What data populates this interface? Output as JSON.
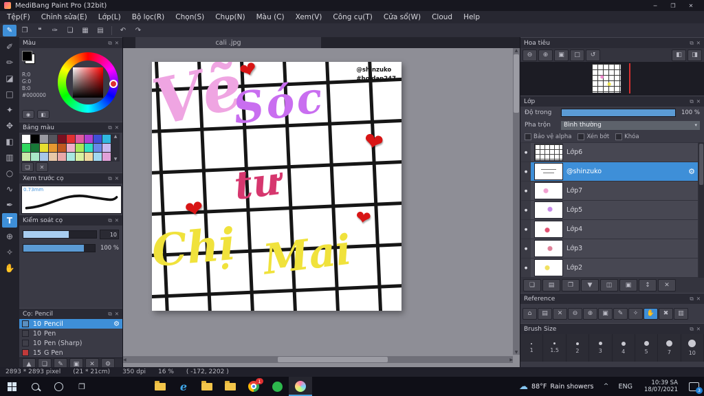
{
  "icons": {
    "minimize": "─",
    "restore": "❐",
    "close": "✕",
    "popout": "⧉",
    "panel_close": "✕",
    "undo": "↶",
    "redo": "↷",
    "gear": "⚙",
    "eye": "●",
    "scroll_up": "▲",
    "scroll_down": "▼",
    "scroll_left": "◀",
    "scroll_right": "▶",
    "dropdown": "▾",
    "chevron_up": "^",
    "taskview": "❐",
    "edge": "e"
  },
  "window": {
    "title": "MediBang Paint Pro (32bit)"
  },
  "menu": {
    "items": [
      "Tệp(F)",
      "Chỉnh sửa(E)",
      "Lớp(L)",
      "Bộ lọc(R)",
      "Chọn(S)",
      "Chụp(N)",
      "Màu (C)",
      "Xem(V)",
      "Công cụ(T)",
      "Cửa sổ(W)",
      "Cloud",
      "Help"
    ]
  },
  "toolbar": {
    "buttons": [
      {
        "name": "paint-mode",
        "glyph": "✎"
      },
      {
        "name": "copy",
        "glyph": "❐"
      },
      {
        "name": "comment",
        "glyph": "❝"
      },
      {
        "name": "brush-edit",
        "glyph": "✑"
      },
      {
        "name": "pages",
        "glyph": "❏"
      },
      {
        "name": "grid-view",
        "glyph": "▦"
      },
      {
        "name": "material-view",
        "glyph": "▤"
      }
    ]
  },
  "tools": [
    {
      "name": "brush-tool",
      "glyph": "✐"
    },
    {
      "name": "pencil-tool",
      "glyph": "✏"
    },
    {
      "name": "eraser-tool",
      "glyph": "◪"
    },
    {
      "name": "select-rect-tool",
      "glyph": "□"
    },
    {
      "name": "magic-wand-tool",
      "glyph": "✦"
    },
    {
      "name": "move-tool",
      "glyph": "✥"
    },
    {
      "name": "fill-tool",
      "glyph": "◧"
    },
    {
      "name": "gradient-tool",
      "glyph": "▥"
    },
    {
      "name": "shape-tool",
      "glyph": "○"
    },
    {
      "name": "lasso-tool",
      "glyph": "∿"
    },
    {
      "name": "pen-tool",
      "glyph": "✒"
    },
    {
      "name": "text-tool",
      "glyph": "T"
    },
    {
      "name": "zoom-tool",
      "glyph": "⊕"
    },
    {
      "name": "eyedropper-tool",
      "glyph": "✧"
    },
    {
      "name": "hand-tool",
      "glyph": "✋"
    }
  ],
  "color_panel": {
    "title": "Màu",
    "r": "R:0",
    "g": "G:0",
    "b": "B:0",
    "hex": "#000000",
    "buttons": [
      {
        "glyph": "◉"
      },
      {
        "glyph": "◧"
      }
    ]
  },
  "palette_panel": {
    "title": "Bảng màu",
    "colors": [
      "#ffffff",
      "#000000",
      "#9a9aa2",
      "#55555d",
      "#7a1020",
      "#e03030",
      "#e05aa0",
      "#b040d0",
      "#4050d8",
      "#30b8e0",
      "#30d860",
      "#187838",
      "#e8e030",
      "#e89830",
      "#c05820",
      "#f0b0c8",
      "#a8e858",
      "#30e0c0",
      "#6888e8",
      "#c8b8f0",
      "#c8e8a8",
      "#a8e8c8",
      "#a8c8e8",
      "#e8c8a8",
      "#e8a8a8",
      "#a8e8e0",
      "#d8f0a0",
      "#f0d8a0",
      "#a0d8f0",
      "#e0a0d8"
    ],
    "actions": [
      {
        "glyph": "❏"
      },
      {
        "glyph": "✕"
      }
    ]
  },
  "preview_panel": {
    "title": "Xem trước cọ",
    "size_label": "0.73mm"
  },
  "control_panel": {
    "title": "Kiểm soát cọ",
    "value1": "10",
    "value2": "100 %"
  },
  "brush_panel": {
    "title": "Cọ: Pencil",
    "brushes": [
      {
        "size": "10",
        "name": "Pencil",
        "chip": "#5a8fc0"
      },
      {
        "size": "10",
        "name": "Pen",
        "chip": "#3f3f49"
      },
      {
        "size": "10",
        "name": "Pen (Sharp)",
        "chip": "#3f3f49"
      },
      {
        "size": "15",
        "name": "G Pen",
        "chip": "#c03a3a"
      }
    ]
  },
  "footer_actions": [
    {
      "glyph": "▲"
    },
    {
      "glyph": "❏"
    },
    {
      "glyph": "✎"
    },
    {
      "glyph": "▣"
    },
    {
      "glyph": "✕"
    },
    {
      "glyph": "⚙"
    }
  ],
  "canvas": {
    "tab": "cali .jpg",
    "credit1": "@shinzuko",
    "credit2": "#hoidap247",
    "heart_glyph": "❤",
    "heart_color": "#d81515",
    "words": [
      {
        "text": "Vẽ",
        "color": "#efa5e2"
      },
      {
        "text": "Sóc",
        "color": "#c96ef0"
      },
      {
        "text": "tư",
        "color": "#d6376e"
      },
      {
        "text": "Chị",
        "color": "#f0e23c"
      },
      {
        "text": "Mai",
        "color": "#f0e23c"
      }
    ]
  },
  "navigator": {
    "title": "Hoa tiêu",
    "buttons": [
      {
        "glyph": "⊖"
      },
      {
        "glyph": "⊕"
      },
      {
        "glyph": "▣"
      },
      {
        "glyph": "□"
      },
      {
        "glyph": "↺"
      }
    ],
    "buttons_right": [
      {
        "glyph": "◧"
      },
      {
        "glyph": "◨"
      }
    ]
  },
  "layer_panel": {
    "title": "Lớp",
    "opacity_label": "Độ trong",
    "opacity_value": "100 %",
    "blend_label": "Pha trộn",
    "blend_value": "Bình thường",
    "cb_alpha": "Bảo vệ alpha",
    "cb_clip": "Xén bớt",
    "cb_lock": "Khóa",
    "layers": [
      {
        "name": "Lớp6"
      },
      {
        "name": "@shinzuko"
      },
      {
        "name": "Lớp7"
      },
      {
        "name": "Lớp5"
      },
      {
        "name": "Lớp4"
      },
      {
        "name": "Lớp3"
      },
      {
        "name": "Lớp2"
      }
    ],
    "actions": [
      {
        "glyph": "❏"
      },
      {
        "glyph": "▤"
      },
      {
        "glyph": "❐"
      },
      {
        "glyph": "▼"
      },
      {
        "glyph": "◫"
      },
      {
        "glyph": "▣"
      },
      {
        "glyph": "↕"
      },
      {
        "glyph": "✕"
      }
    ]
  },
  "reference_panel": {
    "title": "Reference",
    "buttons": [
      {
        "glyph": "⌂"
      },
      {
        "glyph": "▤"
      },
      {
        "glyph": "✕"
      },
      {
        "glyph": "⊖"
      },
      {
        "glyph": "⊕"
      },
      {
        "glyph": "▣"
      },
      {
        "glyph": "✎"
      },
      {
        "glyph": "✧"
      },
      {
        "glyph": "✋"
      },
      {
        "glyph": "✖"
      },
      {
        "glyph": "▥"
      }
    ]
  },
  "brush_size_panel": {
    "title": "Brush Size",
    "sizes": [
      "1",
      "1.5",
      "2",
      "3",
      "4",
      "5",
      "7",
      "10"
    ]
  },
  "status": {
    "dimensions": "2893 * 2893 pixel",
    "size_cm": "(21 * 21cm)",
    "dpi": "350 dpi",
    "zoom": "16 %",
    "coords": "( -172, 2202 )"
  },
  "taskbar": {
    "chrome_badge": "1",
    "weather_temp": "88°F",
    "weather_desc": "Rain showers",
    "lang": "ENG",
    "time": "10:39 SA",
    "date": "18/07/2021",
    "notif_badge": "3"
  }
}
